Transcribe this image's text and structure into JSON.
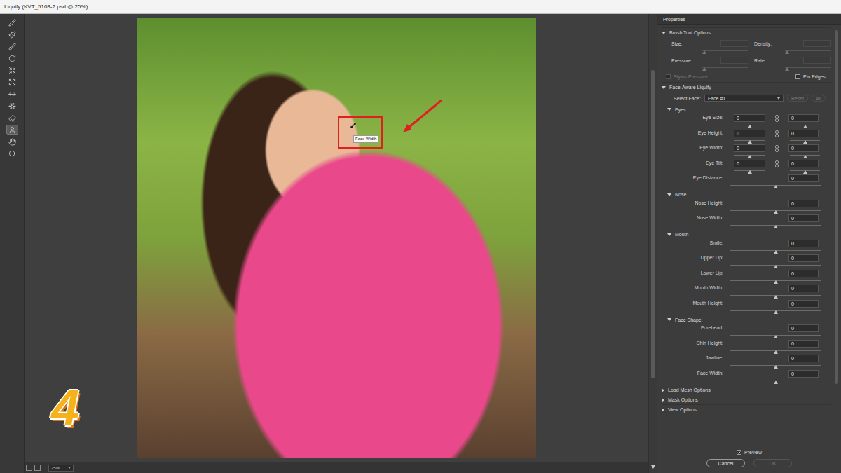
{
  "window": {
    "title": "Liquify (KVT_5103-2.psd @ 25%)"
  },
  "tools": [
    {
      "selected": false
    },
    {
      "selected": false
    },
    {
      "selected": false
    },
    {
      "selected": false
    },
    {
      "selected": false
    },
    {
      "selected": false
    },
    {
      "selected": false
    },
    {
      "selected": false
    },
    {
      "selected": false
    },
    {
      "selected": true
    },
    {
      "selected": false
    },
    {
      "selected": false
    }
  ],
  "canvas": {
    "tooltip": "Face Width",
    "badge": "4",
    "zoom": "25%"
  },
  "properties": {
    "title": "Properties",
    "brush_options": {
      "title": "Brush Tool Options",
      "expanded": true,
      "sliders": [
        {
          "label": "Size:",
          "value": "",
          "level": 0.05,
          "disabled": true
        },
        {
          "label": "Density:",
          "value": "",
          "level": 0.05,
          "disabled": true
        },
        {
          "label": "Pressure:",
          "value": "",
          "level": 0.05,
          "disabled": true
        },
        {
          "label": "Rate:",
          "value": "",
          "level": 0.05,
          "disabled": true
        }
      ],
      "checkboxes": [
        {
          "label": "Stylus Pressure",
          "checked": false,
          "disabled": true
        },
        {
          "label": "Pin Edges",
          "checked": false,
          "disabled": false
        }
      ]
    },
    "face_aware": {
      "title": "Face-Aware Liquify",
      "expanded": true,
      "select": {
        "label": "Select Face:",
        "value": "Face #1"
      },
      "buttons": [
        {
          "label": "Reset",
          "disabled": true
        },
        {
          "label": "All",
          "disabled": true
        }
      ],
      "groups": [
        {
          "title": "Eyes",
          "expanded": true,
          "rows": [
            {
              "label": "Eye Size:",
              "kind": "pair",
              "values": [
                "0",
                "0"
              ],
              "levels": [
                0.5,
                0.5
              ]
            },
            {
              "label": "Eye Height:",
              "kind": "pair",
              "values": [
                "0",
                "0"
              ],
              "levels": [
                0.5,
                0.5
              ]
            },
            {
              "label": "Eye Width:",
              "kind": "pair",
              "values": [
                "0",
                "0"
              ],
              "levels": [
                0.5,
                0.5
              ]
            },
            {
              "label": "Eye Tilt:",
              "kind": "pair",
              "values": [
                "0",
                "0"
              ],
              "levels": [
                0.5,
                0.5
              ]
            },
            {
              "label": "Eye Distance:",
              "kind": "single",
              "value": "0",
              "level": 0.5
            }
          ]
        },
        {
          "title": "Nose",
          "expanded": true,
          "rows": [
            {
              "label": "Nose Height:",
              "kind": "single",
              "value": "0",
              "level": 0.5
            },
            {
              "label": "Nose Width:",
              "kind": "single",
              "value": "0",
              "level": 0.5
            }
          ]
        },
        {
          "title": "Mouth",
          "expanded": true,
          "rows": [
            {
              "label": "Smile:",
              "kind": "single",
              "value": "0",
              "level": 0.5
            },
            {
              "label": "Upper Lip:",
              "kind": "single",
              "value": "0",
              "level": 0.5
            },
            {
              "label": "Lower Lip:",
              "kind": "single",
              "value": "0",
              "level": 0.5
            },
            {
              "label": "Mouth Width:",
              "kind": "single",
              "value": "0",
              "level": 0.5
            },
            {
              "label": "Mouth Height:",
              "kind": "single",
              "value": "0",
              "level": 0.5
            }
          ]
        },
        {
          "title": "Face Shape",
          "expanded": true,
          "rows": [
            {
              "label": "Forehead:",
              "kind": "single",
              "value": "0",
              "level": 0.5
            },
            {
              "label": "Chin Height:",
              "kind": "single",
              "value": "0",
              "level": 0.5
            },
            {
              "label": "Jawline:",
              "kind": "single",
              "value": "0",
              "level": 0.5
            },
            {
              "label": "Face Width:",
              "kind": "single",
              "value": "0",
              "level": 0.5
            }
          ]
        }
      ]
    },
    "sections": [
      {
        "title": "Load Mesh Options",
        "expanded": false
      },
      {
        "title": "Mask Options",
        "expanded": false
      },
      {
        "title": "View Options",
        "expanded": false
      }
    ],
    "preview": {
      "label": "Preview",
      "checked": true
    },
    "buttons": [
      {
        "label": "Cancel",
        "disabled": false
      },
      {
        "label": "OK",
        "disabled": true
      }
    ]
  }
}
